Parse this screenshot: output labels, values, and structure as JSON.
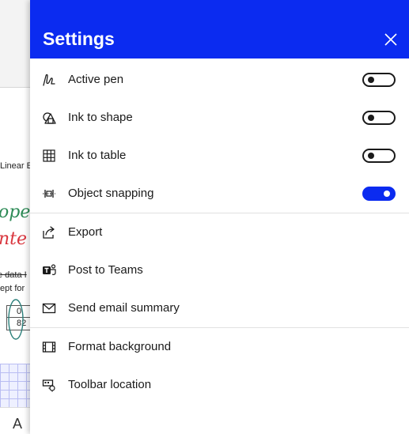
{
  "background": {
    "text_fragments": [
      "Linear E",
      "ope",
      "nte",
      "e data I",
      "ept for",
      "0",
      "82",
      "A"
    ],
    "colors": {
      "ink_green": "#2e8b57",
      "ink_red": "#d9363e",
      "grid": "#b9bdf2"
    }
  },
  "settings": {
    "title": "Settings",
    "close_icon": "close-icon",
    "accent": "#0b2bf0",
    "toggles": [
      {
        "label": "Active pen",
        "icon": "pen-icon",
        "on": false
      },
      {
        "label": "Ink to shape",
        "icon": "shapes-icon",
        "on": false
      },
      {
        "label": "Ink to table",
        "icon": "table-icon",
        "on": false
      },
      {
        "label": "Object snapping",
        "icon": "snapping-icon",
        "on": true
      }
    ],
    "actions": [
      {
        "label": "Export",
        "icon": "export-icon"
      },
      {
        "label": "Post to Teams",
        "icon": "teams-icon"
      },
      {
        "label": "Send email summary",
        "icon": "mail-icon"
      }
    ],
    "options": [
      {
        "label": "Format background",
        "icon": "background-icon"
      },
      {
        "label": "Toolbar location",
        "icon": "toolbar-location-icon"
      }
    ]
  }
}
